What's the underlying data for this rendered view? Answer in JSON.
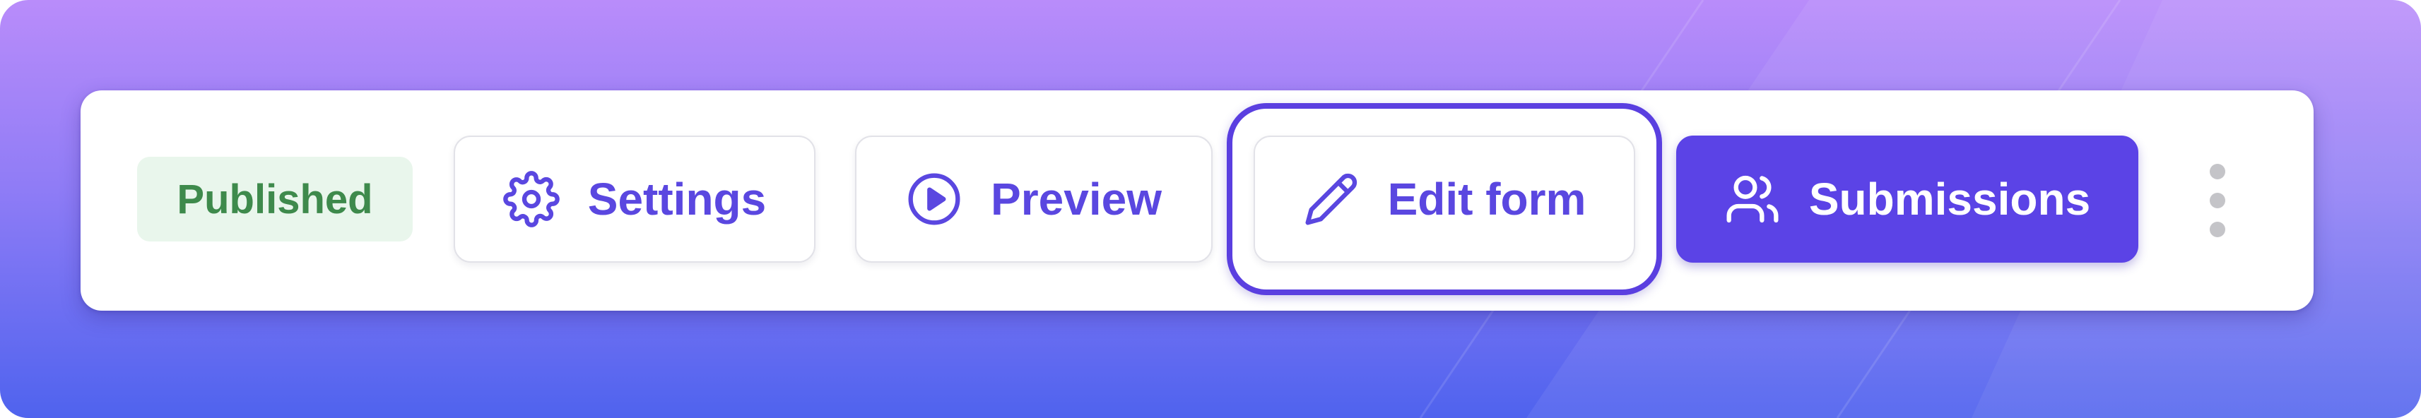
{
  "status": {
    "badge_label": "Published"
  },
  "toolbar": {
    "settings_label": "Settings",
    "preview_label": "Preview",
    "edit_label": "Edit form",
    "submissions_label": "Submissions"
  },
  "icons": {
    "settings": "gear-icon",
    "preview": "play-circle-icon",
    "edit": "pencil-icon",
    "submissions": "users-icon",
    "more": "more-vertical-icon"
  },
  "colors": {
    "accent": "#5b43e6",
    "accent_text": "#5a47e0",
    "badge_bg": "#e9f6ec",
    "badge_text": "#3e8a4c",
    "bg_top": "#b98cfa",
    "bg_bottom": "#4f63ee"
  }
}
